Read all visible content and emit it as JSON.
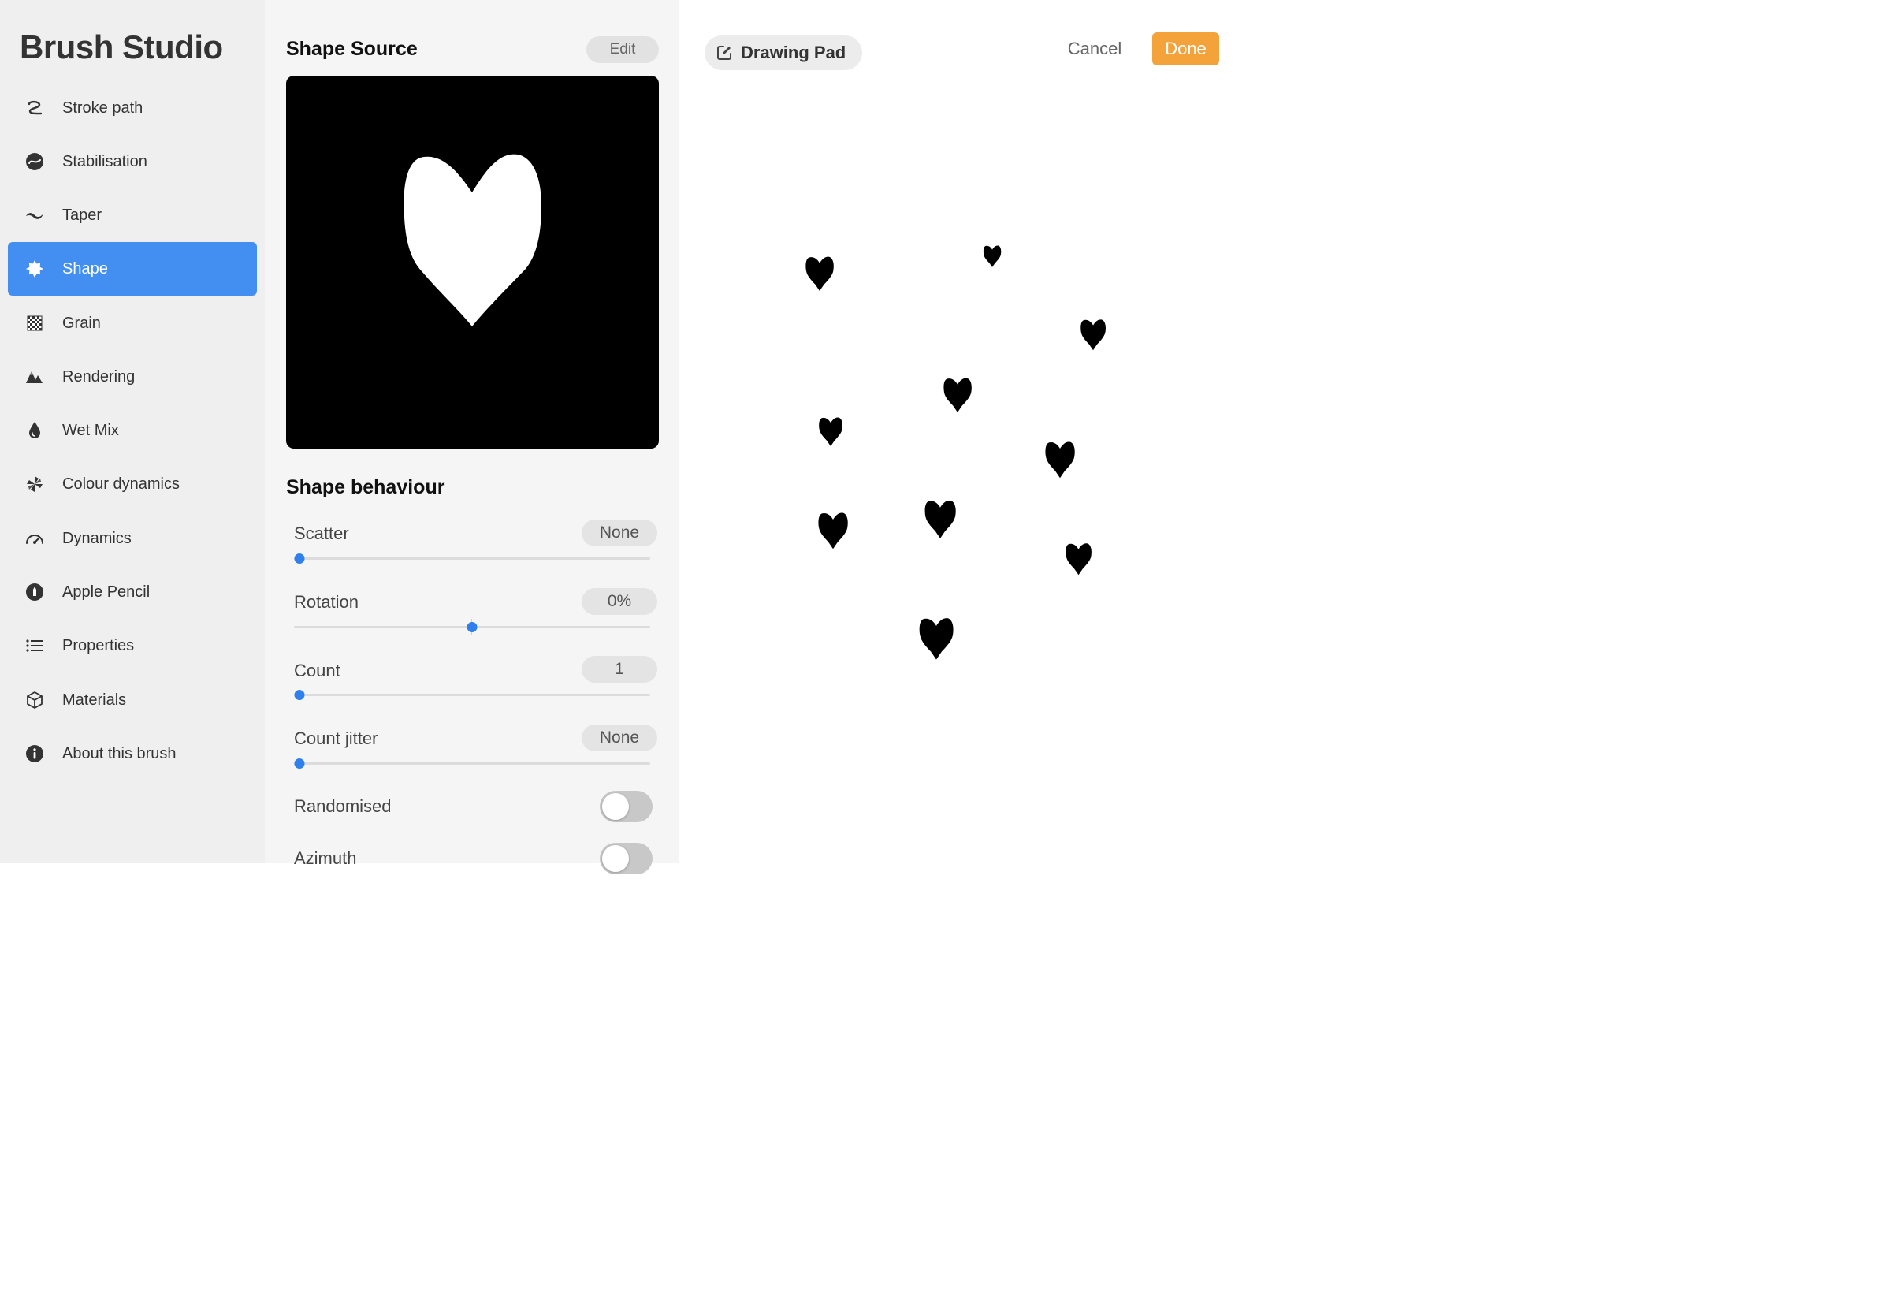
{
  "app": {
    "title": "Brush Studio"
  },
  "sidebar": {
    "items": [
      {
        "label": "Stroke path",
        "icon": "stroke-path-icon",
        "active": false
      },
      {
        "label": "Stabilisation",
        "icon": "stabilisation-icon",
        "active": false
      },
      {
        "label": "Taper",
        "icon": "taper-icon",
        "active": false
      },
      {
        "label": "Shape",
        "icon": "shape-icon",
        "active": true
      },
      {
        "label": "Grain",
        "icon": "grain-icon",
        "active": false
      },
      {
        "label": "Rendering",
        "icon": "rendering-icon",
        "active": false
      },
      {
        "label": "Wet Mix",
        "icon": "wet-mix-icon",
        "active": false
      },
      {
        "label": "Colour dynamics",
        "icon": "colour-dynamics-icon",
        "active": false
      },
      {
        "label": "Dynamics",
        "icon": "dynamics-icon",
        "active": false
      },
      {
        "label": "Apple Pencil",
        "icon": "apple-pencil-icon",
        "active": false
      },
      {
        "label": "Properties",
        "icon": "properties-icon",
        "active": false
      },
      {
        "label": "Materials",
        "icon": "materials-icon",
        "active": false
      },
      {
        "label": "About this brush",
        "icon": "info-icon",
        "active": false
      }
    ]
  },
  "panel": {
    "shape_source": {
      "title": "Shape Source",
      "edit_label": "Edit",
      "preview_icon": "heart-shape"
    },
    "shape_behaviour": {
      "title": "Shape behaviour",
      "settings": [
        {
          "label": "Scatter",
          "value": "None",
          "level": 0.0
        },
        {
          "label": "Rotation",
          "value": "0%",
          "level": 0.5
        },
        {
          "label": "Count",
          "value": "1",
          "level": 0.0
        },
        {
          "label": "Count jitter",
          "value": "None",
          "level": 0.0
        }
      ],
      "toggles": [
        {
          "label": "Randomised",
          "on": false
        },
        {
          "label": "Azimuth",
          "on": false
        }
      ]
    }
  },
  "drawing_pad": {
    "tab_label": "Drawing Pad",
    "tab_icon": "edit-square-icon",
    "cancel_label": "Cancel",
    "done_label": "Done",
    "stamp_icon": "heart-stamp"
  },
  "colors": {
    "accent_blue": "#438ef1",
    "slider_blue": "#2f80ed",
    "done_orange": "#f4a33b"
  }
}
